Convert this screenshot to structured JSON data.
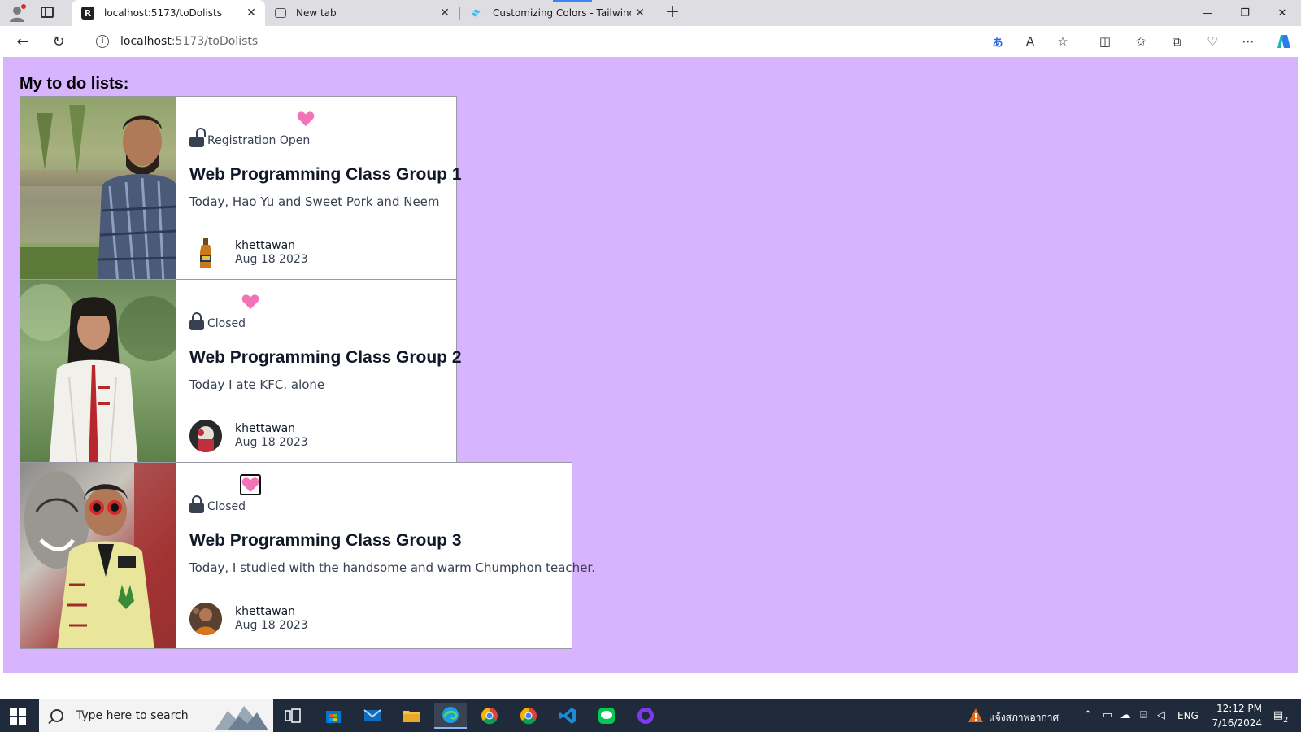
{
  "browser": {
    "tabs": [
      {
        "title": "localhost:5173/toDolists",
        "active": true,
        "icon": "react-router-icon"
      },
      {
        "title": "New tab",
        "active": false,
        "icon": "new-tab-page-icon"
      },
      {
        "title": "Customizing Colors - Tailwind CS",
        "active": false,
        "icon": "tailwind-icon"
      }
    ],
    "address": {
      "host": "localhost",
      "path": ":5173/toDolists"
    },
    "window_controls": [
      "minimize",
      "restore",
      "close"
    ]
  },
  "page": {
    "title": "My to do lists:",
    "background": "#d8b4fe",
    "cards": [
      {
        "status": "Registration Open",
        "lock_state": "open",
        "title": "Web Programming Class Group 1",
        "description": "Today, Hao Yu and Sweet Pork and Neem",
        "author": "khettawan",
        "date": "Aug 18 2023",
        "heart_color": "#f472b6",
        "heart_focused": false,
        "avatar": "beer-bottle"
      },
      {
        "status": "Closed",
        "lock_state": "closed",
        "title": "Web Programming Class Group 2",
        "description": "Today I ate KFC. alone",
        "author": "khettawan",
        "date": "Aug 18 2023",
        "heart_color": "#f472b6",
        "heart_focused": false,
        "avatar": "person-photo"
      },
      {
        "status": "Closed",
        "lock_state": "closed",
        "title": "Web Programming Class Group 3",
        "description": "Today, I studied with the handsome and warm Chumphon teacher.",
        "author": "khettawan",
        "date": "Aug 18 2023",
        "heart_color": "#f472b6",
        "heart_focused": true,
        "avatar": "person-photo"
      }
    ]
  },
  "taskbar": {
    "search_placeholder": "Type here to search",
    "weather_text": "แจ้งสภาพอากาศ",
    "language": "ENG",
    "time": "12:12 PM",
    "date": "7/16/2024",
    "notification_count": "2"
  }
}
